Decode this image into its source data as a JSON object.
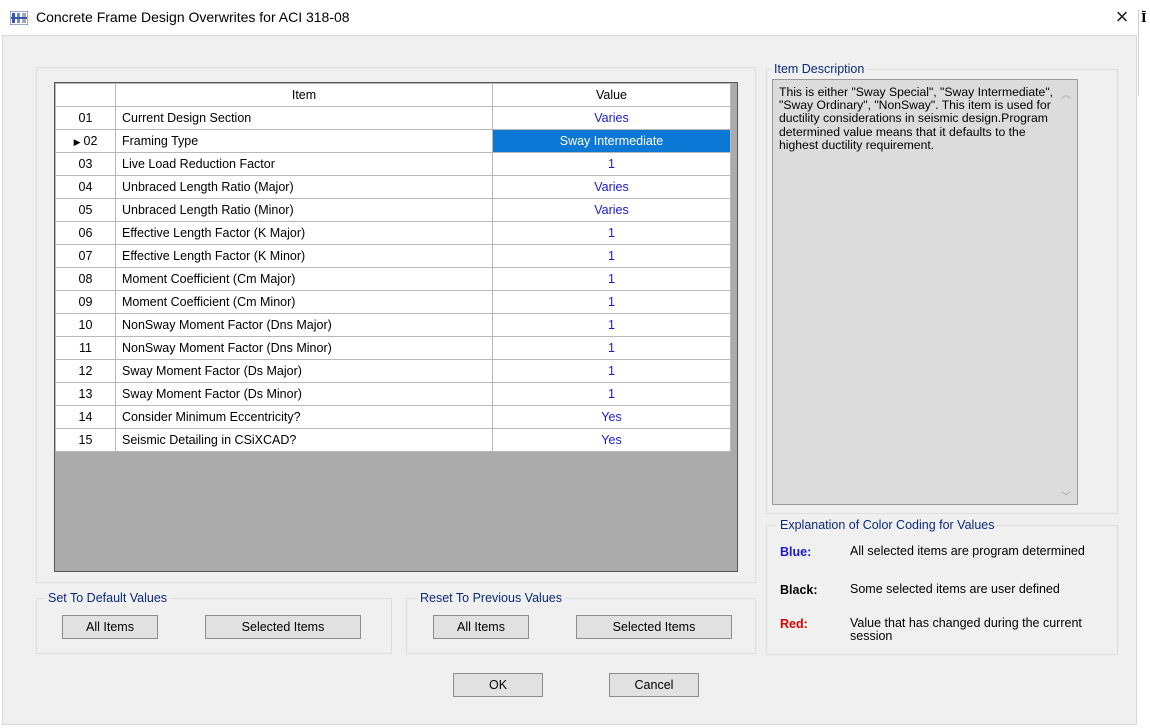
{
  "window": {
    "title": "Concrete Frame Design Overwrites for ACI 318-08",
    "close_glyph": "×",
    "edge_glyph": "Ī"
  },
  "grid": {
    "header": {
      "num": "",
      "item": "Item",
      "value": "Value"
    },
    "selected_marker": "▶",
    "rows": [
      {
        "num": "01",
        "item": "Current Design Section",
        "value": "Varies"
      },
      {
        "num": "02",
        "item": "Framing Type",
        "value": "Sway Intermediate"
      },
      {
        "num": "03",
        "item": "Live Load Reduction Factor",
        "value": "1"
      },
      {
        "num": "04",
        "item": "Unbraced Length Ratio (Major)",
        "value": "Varies"
      },
      {
        "num": "05",
        "item": "Unbraced Length Ratio (Minor)",
        "value": "Varies"
      },
      {
        "num": "06",
        "item": "Effective Length Factor (K Major)",
        "value": "1"
      },
      {
        "num": "07",
        "item": "Effective Length Factor (K Minor)",
        "value": "1"
      },
      {
        "num": "08",
        "item": "Moment Coefficient (Cm Major)",
        "value": "1"
      },
      {
        "num": "09",
        "item": "Moment Coefficient (Cm Minor)",
        "value": "1"
      },
      {
        "num": "10",
        "item": "NonSway Moment Factor (Dns Major)",
        "value": "1"
      },
      {
        "num": "11",
        "item": "NonSway Moment Factor (Dns Minor)",
        "value": "1"
      },
      {
        "num": "12",
        "item": "Sway Moment Factor (Ds Major)",
        "value": "1"
      },
      {
        "num": "13",
        "item": "Sway Moment Factor (Ds Minor)",
        "value": "1"
      },
      {
        "num": "14",
        "item": "Consider Minimum Eccentricity?",
        "value": "Yes"
      },
      {
        "num": "15",
        "item": "Seismic Detailing in CSiXCAD?",
        "value": "Yes"
      }
    ],
    "selected_row": "02"
  },
  "item_description": {
    "label": "Item Description",
    "text": "This is either \"Sway Special\", \"Sway Intermediate\", \"Sway Ordinary\", \"NonSway\".  This item is used for ductility considerations in seismic design.Program determined value means that it defaults to the highest ductility requirement."
  },
  "color_coding": {
    "label": "Explanation of Color Coding for Values",
    "blue_key": "Blue:",
    "blue_text": "All selected items are program determined",
    "black_key": "Black:",
    "black_text": "Some selected items are user defined",
    "red_key": "Red:",
    "red_text": "Value that has changed during the current session"
  },
  "set_default": {
    "label": "Set To Default Values",
    "all_items": "All Items",
    "selected_items": "Selected Items"
  },
  "reset_previous": {
    "label": "Reset To Previous Values",
    "all_items": "All Items",
    "selected_items": "Selected Items"
  },
  "buttons": {
    "ok": "OK",
    "cancel": "Cancel"
  },
  "colors": {
    "program_determined": "#1a1acc",
    "user_defined": "#000000",
    "changed": "#dd0000",
    "selection": "#0a78d4",
    "group_label": "#0a2a7a"
  }
}
